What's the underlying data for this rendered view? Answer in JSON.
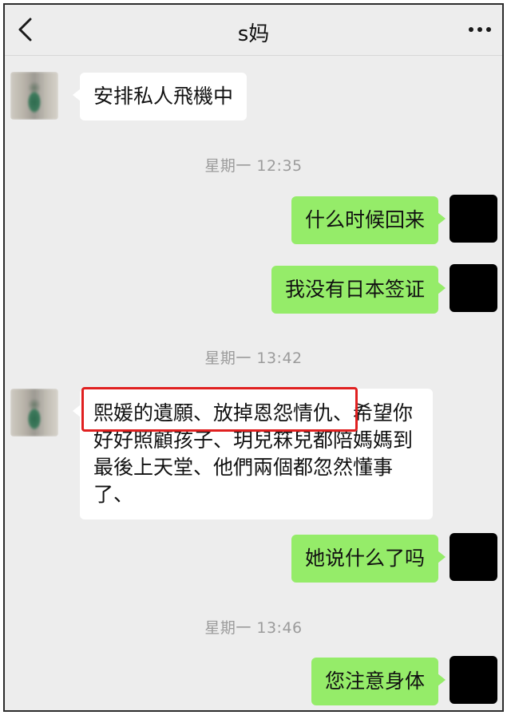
{
  "header": {
    "title": "s妈",
    "back_icon": "chevron-left-icon",
    "more_icon": "more-dots-icon"
  },
  "messages": [
    {
      "type": "received",
      "text": "安排私人飛機中"
    },
    {
      "type": "timestamp",
      "text": "星期一 12:35"
    },
    {
      "type": "sent",
      "text": "什么时候回来"
    },
    {
      "type": "sent",
      "text": "我没有日本签证"
    },
    {
      "type": "timestamp",
      "text": "星期一 13:42"
    },
    {
      "type": "received",
      "text": "熙媛的遺願、放掉恩怨情仇、希望你\n好好照顧孩子、玥兒箖兒都陪媽媽到\n最後上天堂、他們兩個都忽然懂事\n了、"
    },
    {
      "type": "sent",
      "text": "她说什么了吗"
    },
    {
      "type": "timestamp",
      "text": "星期一 13:46"
    },
    {
      "type": "sent",
      "text": "您注意身体"
    }
  ],
  "colors": {
    "chat_background": "#ededed",
    "sent_bubble": "#95ec69",
    "received_bubble": "#ffffff",
    "highlight": "#e02020"
  }
}
